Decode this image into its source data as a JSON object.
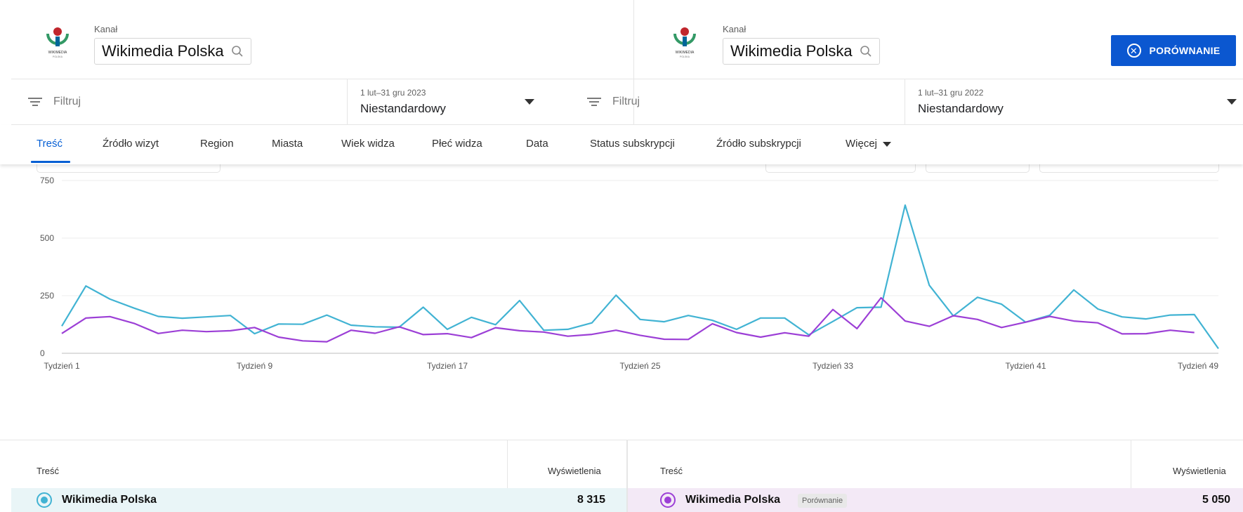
{
  "header": {
    "left": {
      "channel_label": "Kanał",
      "channel_name": "Wikimedia Polska"
    },
    "right": {
      "channel_label": "Kanał",
      "channel_name": "Wikimedia Polska"
    },
    "compare_button": "PORÓWNANIE"
  },
  "filters": {
    "left": {
      "filter_label": "Filtruj",
      "date_range": "1 lut–31 gru 2023",
      "date_type": "Niestandardowy"
    },
    "right": {
      "filter_label": "Filtruj",
      "date_range": "1 lut–31 gru 2022",
      "date_type": "Niestandardowy"
    }
  },
  "tabs": [
    {
      "label": "Treść",
      "active": true
    },
    {
      "label": "Źródło wizyt",
      "active": false
    },
    {
      "label": "Region",
      "active": false
    },
    {
      "label": "Miasta",
      "active": false
    },
    {
      "label": "Wiek widza",
      "active": false
    },
    {
      "label": "Płeć widza",
      "active": false
    },
    {
      "label": "Data",
      "active": false
    },
    {
      "label": "Status subskrypcji",
      "active": false
    },
    {
      "label": "Źródło subskrypcji",
      "active": false
    },
    {
      "label": "Więcej",
      "active": false
    }
  ],
  "chart_data": {
    "type": "line",
    "ylim": [
      0,
      750
    ],
    "yticks": [
      0,
      250,
      500,
      750
    ],
    "xtick_labels": [
      {
        "week": 1,
        "label": "Tydzień 1"
      },
      {
        "week": 9,
        "label": "Tydzień 9"
      },
      {
        "week": 17,
        "label": "Tydzień 17"
      },
      {
        "week": 25,
        "label": "Tydzień 25"
      },
      {
        "week": 33,
        "label": "Tydzień 33"
      },
      {
        "week": 41,
        "label": "Tydzień 41"
      },
      {
        "week": 49,
        "label": "Tydzień 49"
      }
    ],
    "grid": true,
    "series": [
      {
        "color": "#41b3d3",
        "values": [
          118,
          292,
          235,
          196,
          160,
          152,
          158,
          164,
          85,
          127,
          126,
          166,
          122,
          115,
          113,
          200,
          104,
          156,
          124,
          229,
          100,
          104,
          132,
          252,
          147,
          137,
          164,
          143,
          104,
          153,
          153,
          80,
          138,
          198,
          200,
          643,
          295,
          162,
          243,
          213,
          135,
          165,
          275,
          192,
          158,
          149,
          166,
          168,
          20
        ]
      },
      {
        "color": "#9c3fd6",
        "values": [
          86,
          153,
          159,
          130,
          86,
          100,
          94,
          98,
          112,
          70,
          54,
          50,
          100,
          87,
          115,
          81,
          85,
          68,
          111,
          98,
          92,
          74,
          82,
          100,
          78,
          61,
          60,
          128,
          90,
          70,
          89,
          74,
          190,
          107,
          241,
          140,
          117,
          163,
          147,
          112,
          135,
          160,
          140,
          132,
          84,
          85,
          100,
          90
        ]
      }
    ]
  },
  "table": {
    "left": {
      "col_name": "Treść",
      "col_value": "Wyświetlenia",
      "row_name": "Wikimedia Polska",
      "row_value": "8 315"
    },
    "right": {
      "col_name": "Treść",
      "col_value": "Wyświetlenia",
      "row_name": "Wikimedia Polska",
      "badge": "Porównanie",
      "row_value": "5 050"
    }
  },
  "colors": {
    "accent": "#0b57d0",
    "current_series": "#41b3d3",
    "compare_series": "#9c3fd6",
    "current_row": "#e9f5f7",
    "compare_row": "#f3e9f6"
  }
}
